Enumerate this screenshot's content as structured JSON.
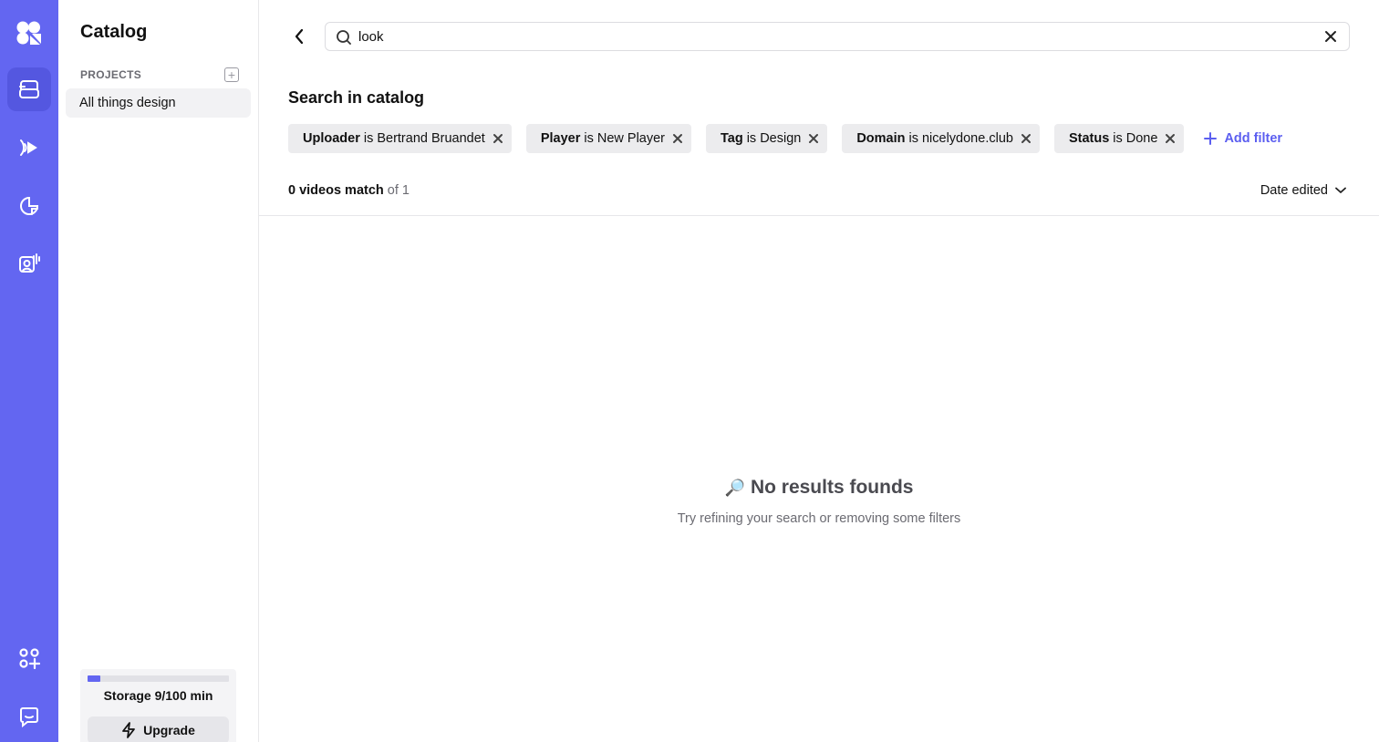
{
  "colors": {
    "brand": "#6366f1",
    "accent": "#5b5ef0"
  },
  "rail": {
    "items": [
      {
        "icon": "logo-icon"
      },
      {
        "icon": "catalog-icon",
        "active": true
      },
      {
        "icon": "player-icon"
      },
      {
        "icon": "analytics-icon"
      },
      {
        "icon": "live-icon"
      },
      {
        "icon": "apps-icon"
      },
      {
        "icon": "chat-icon"
      }
    ]
  },
  "sidebar": {
    "title": "Catalog",
    "section_label": "PROJECTS",
    "projects": [
      {
        "label": "All things design",
        "selected": true
      }
    ],
    "storage": {
      "label": "Storage 9/100 min",
      "used": 9,
      "total": 100
    },
    "upgrade_label": "Upgrade"
  },
  "search": {
    "value": "look"
  },
  "main": {
    "heading": "Search in catalog",
    "filters": [
      {
        "key": "Uploader",
        "op": "is",
        "value": "Bertrand Bruandet"
      },
      {
        "key": "Player",
        "op": "is",
        "value": "New Player"
      },
      {
        "key": "Tag",
        "op": "is",
        "value": "Design"
      },
      {
        "key": "Domain",
        "op": "is",
        "value": "nicelydone.club"
      },
      {
        "key": "Status",
        "op": "is",
        "value": "Done"
      }
    ],
    "add_filter_label": "Add filter",
    "results": {
      "count_label": "0 videos match",
      "of_label": "of 1"
    },
    "sort_label": "Date edited",
    "empty": {
      "emoji": "🔎",
      "title": "No results founds",
      "description": "Try refining your search or removing some filters"
    }
  }
}
